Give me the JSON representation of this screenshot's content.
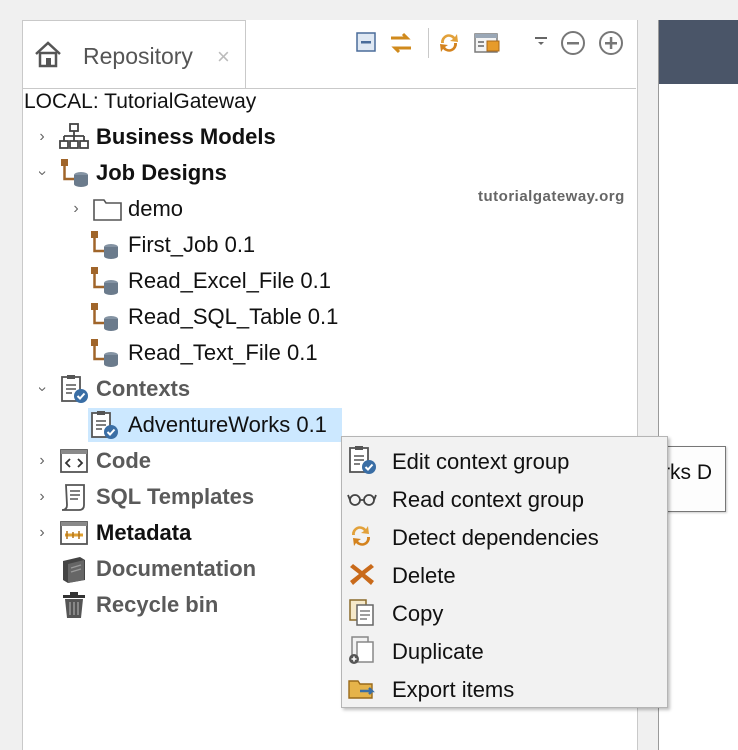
{
  "tab": {
    "title": "Repository",
    "close": "×"
  },
  "toolbar": {
    "icons": [
      "collapse-icon",
      "link-editor-icon",
      "refresh-icon",
      "filter-icon",
      "view-menu-icon",
      "minimize-icon",
      "maximize-icon"
    ]
  },
  "root": {
    "label": "LOCAL: TutorialGateway"
  },
  "tree": {
    "business_models": "Business Models",
    "job_designs": "Job Designs",
    "demo": "demo",
    "first_job": "First_Job 0.1",
    "read_excel": "Read_Excel_File 0.1",
    "read_sql": "Read_SQL_Table 0.1",
    "read_text": "Read_Text_File 0.1",
    "contexts": "Contexts",
    "adventureworks": "AdventureWorks 0.1",
    "code": "Code",
    "sql_templates": "SQL Templates",
    "metadata": "Metadata",
    "documentation": "Documentation",
    "recycle_bin": "Recycle bin"
  },
  "watermark": "tutorialgateway.org",
  "tooltip": "rks D",
  "context_menu": {
    "edit": "Edit context group",
    "read": "Read context group",
    "detect": "Detect dependencies",
    "delete": "Delete",
    "copy": "Copy",
    "duplicate": "Duplicate",
    "export": "Export items"
  },
  "colors": {
    "selection": "#cce8ff",
    "job_brown": "#a0652a",
    "db_gray": "#6b7b8c",
    "context_blue": "#3a6ea5"
  }
}
